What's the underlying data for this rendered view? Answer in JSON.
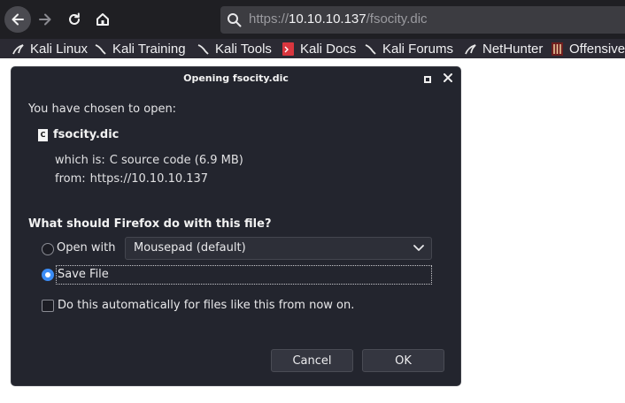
{
  "browser": {
    "url_scheme": "https://",
    "url_host": "10.10.10.137",
    "url_path": "/fsocity.dic",
    "bookmarks": [
      {
        "label": "Kali Linux",
        "icon": "kali-dragon-icon"
      },
      {
        "label": "Kali Training",
        "icon": "kali-dragon-icon"
      },
      {
        "label": "Kali Tools",
        "icon": "kali-dragon-icon"
      },
      {
        "label": "Kali Docs",
        "icon": "kali-docs-icon"
      },
      {
        "label": "Kali Forums",
        "icon": "kali-dragon-icon"
      },
      {
        "label": "NetHunter",
        "icon": "nethunter-icon"
      },
      {
        "label": "Offensive",
        "icon": "offensive-security-icon"
      }
    ]
  },
  "dialog": {
    "title": "Opening fsocity.dic",
    "chosen_text": "You have chosen to open:",
    "file_icon_letter": "C",
    "file_name": "fsocity.dic",
    "which_is_label": "which is:",
    "which_is_value": "C source code (6.9 MB)",
    "from_label": "from:",
    "from_value": "https://10.10.10.137",
    "question": "What should Firefox do with this file?",
    "open_with_label": "Open with",
    "open_with_app": "Mousepad (default)",
    "save_file_label": "Save File",
    "selected_option": "Save File",
    "auto_label": "Do this automatically for files like this from now on.",
    "auto_checked": false,
    "cancel_label": "Cancel",
    "ok_label": "OK"
  },
  "colors": {
    "dialog_bg": "#23252e",
    "toolbar_bg": "#1f1f23",
    "accent": "#3b8cf5"
  }
}
